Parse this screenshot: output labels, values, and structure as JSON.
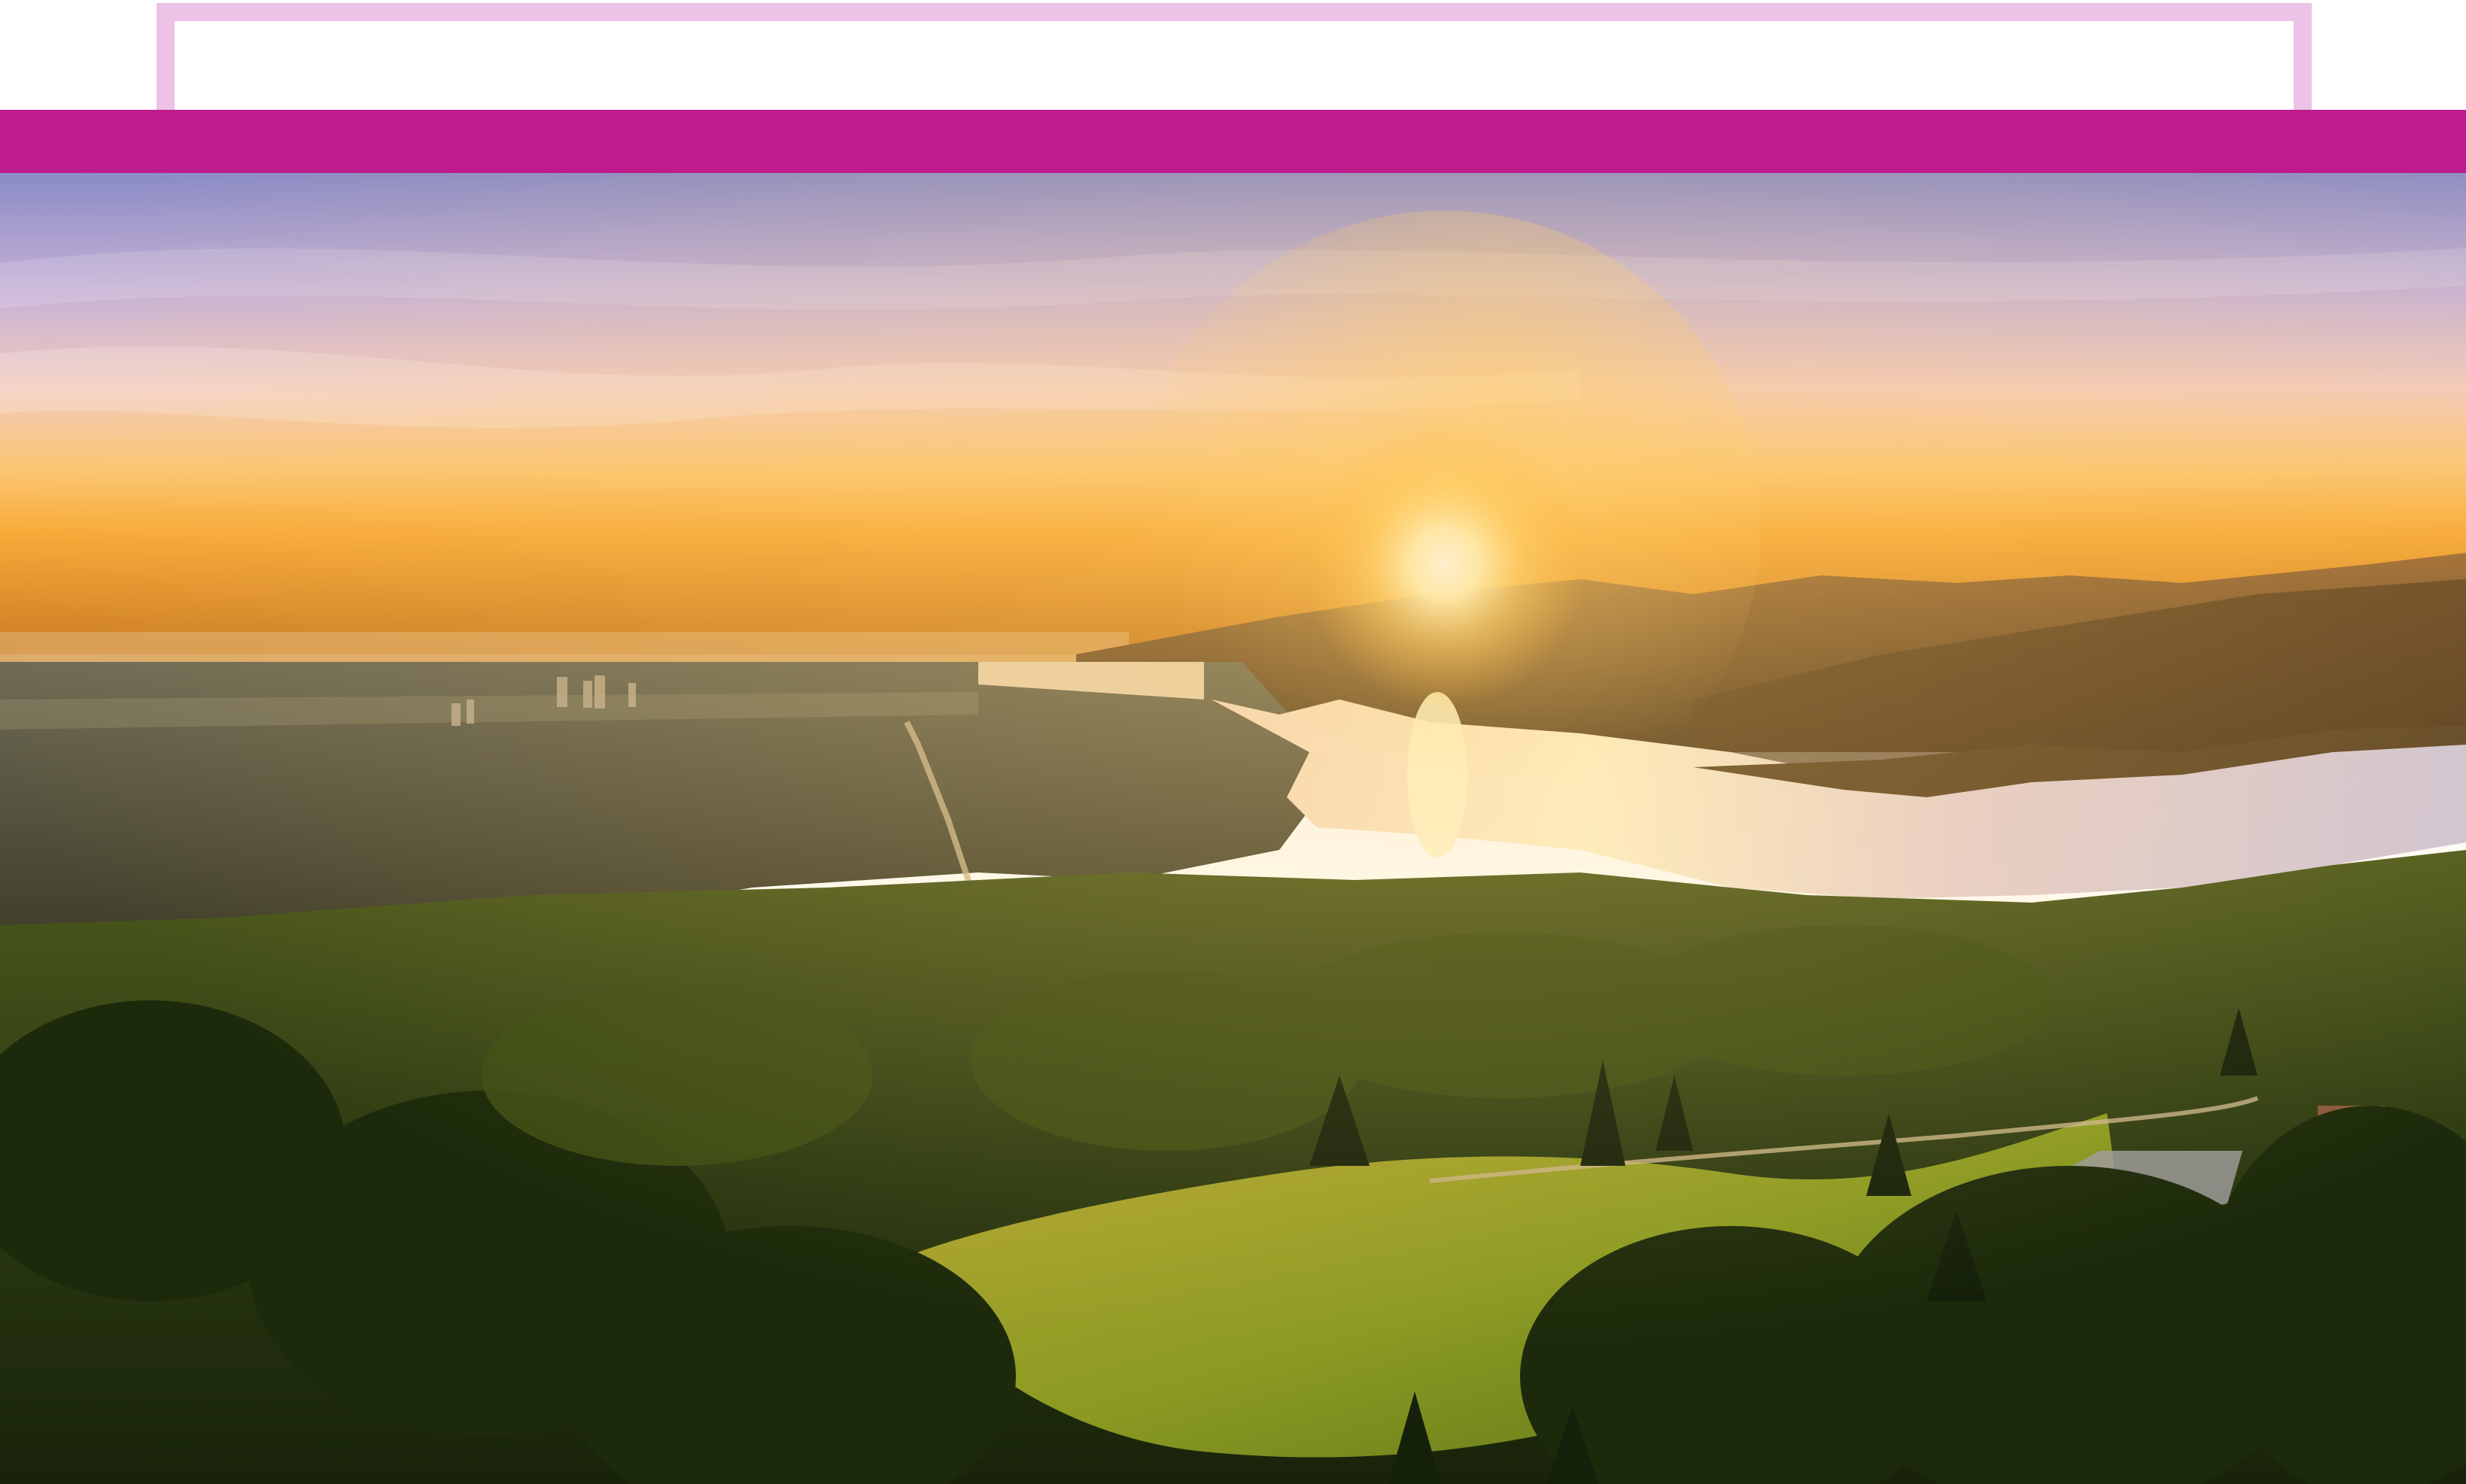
{
  "colors": {
    "frame_outline": "#ecc3e6",
    "header_bar": "#be1c8c",
    "sky_top": "#8e8fc9",
    "sky_mid": "#f1c9c6",
    "sky_horizon": "#fbb23f",
    "sun": "#fffbe0",
    "mountains": "#7b5330",
    "water": "#e9d4cf",
    "forest_dark": "#21300f",
    "forest_mid": "#4a5e17",
    "meadow": "#8a9a21"
  },
  "hero": {
    "icon": "landscape-photo"
  }
}
